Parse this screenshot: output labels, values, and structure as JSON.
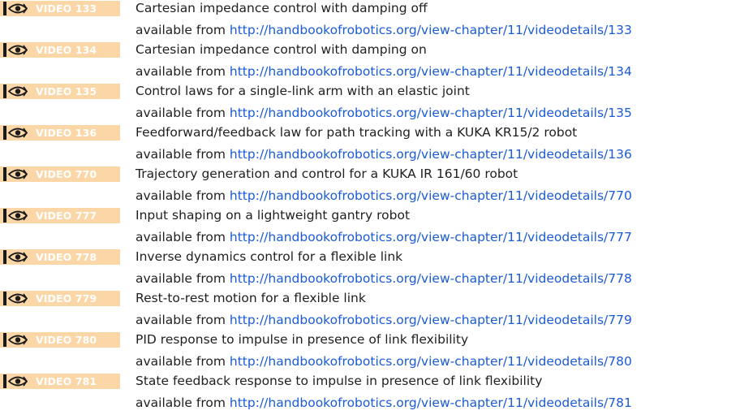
{
  "icon": "eye-video-icon",
  "colors": {
    "badge_bg": "#fbd7a8",
    "badge_text": "#ffffff",
    "link": "#1a5bd6",
    "text": "#1f1f1f"
  },
  "entries": [
    {
      "badge": "VIDEO 133",
      "title": "Cartesian impedance control with damping off",
      "prefix": "available from",
      "url": "http://handbookofrobotics.org/view-chapter/11/videodetails/133"
    },
    {
      "badge": "VIDEO 134",
      "title": "Cartesian impedance control with damping on",
      "prefix": "available from",
      "url": "http://handbookofrobotics.org/view-chapter/11/videodetails/134"
    },
    {
      "badge": "VIDEO 135",
      "title": "Control laws for a single-link arm with an elastic joint",
      "prefix": "available from",
      "url": "http://handbookofrobotics.org/view-chapter/11/videodetails/135"
    },
    {
      "badge": "VIDEO 136",
      "title": "Feedforward/feedback law for path tracking with a KUKA KR15/2 robot",
      "prefix": "available from",
      "url": "http://handbookofrobotics.org/view-chapter/11/videodetails/136"
    },
    {
      "badge": "VIDEO 770",
      "title": "Trajectory generation and control for a KUKA IR 161/60 robot",
      "prefix": "available from",
      "url": "http://handbookofrobotics.org/view-chapter/11/videodetails/770"
    },
    {
      "badge": "VIDEO 777",
      "title": "Input shaping on a lightweight gantry robot",
      "prefix": "available from",
      "url": "http://handbookofrobotics.org/view-chapter/11/videodetails/777"
    },
    {
      "badge": "VIDEO 778",
      "title": "Inverse dynamics control for a flexible link",
      "prefix": "available from",
      "url": "http://handbookofrobotics.org/view-chapter/11/videodetails/778"
    },
    {
      "badge": "VIDEO 779",
      "title": "Rest-to-rest motion for a flexible link",
      "prefix": "available from",
      "url": "http://handbookofrobotics.org/view-chapter/11/videodetails/779"
    },
    {
      "badge": "VIDEO 780",
      "title": "PID response to impulse in presence of link flexibility",
      "prefix": "available from",
      "url": "http://handbookofrobotics.org/view-chapter/11/videodetails/780"
    },
    {
      "badge": "VIDEO 781",
      "title": "State feedback response to impulse in presence of link flexibility",
      "prefix": "available from",
      "url": "http://handbookofrobotics.org/view-chapter/11/videodetails/781"
    }
  ]
}
